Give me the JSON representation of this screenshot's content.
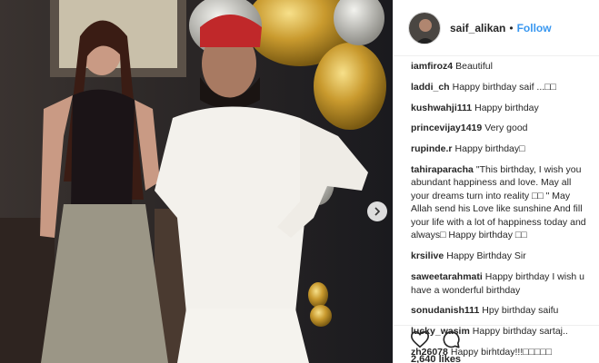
{
  "post": {
    "username": "saif_alikan",
    "separator": "•",
    "follow_label": "Follow",
    "likes": "2,640 likes"
  },
  "comments": [
    {
      "user": "iamfiroz4",
      "text": "Beautiful"
    },
    {
      "user": "laddi_ch",
      "text": "Happy birthday saif ...□□"
    },
    {
      "user": "kushwahji111",
      "text": "Happy birthday"
    },
    {
      "user": "princevijay1419",
      "text": "Very good"
    },
    {
      "user": "rupinde.r",
      "text": "Happy birthday□"
    },
    {
      "user": "tahiraparacha",
      "text": "\"This birthday, I wish you abundant happiness and love. May all your dreams turn into reality □□ \" May Allah send his Love like sunshine And fill your life with a lot of happiness today and always□ Happy birthday □□"
    },
    {
      "user": "krsilive",
      "text": "Happy Birthday Sir"
    },
    {
      "user": "saweetarahmati",
      "text": "Happy birthday I wish u have a wonderful birthday"
    },
    {
      "user": "sonudanish111",
      "text": "Hpy birthday saifu"
    },
    {
      "user": "lucky_wasim",
      "text": "Happy birthday sartaj.."
    },
    {
      "user": "zh26078",
      "text": "Happy birhtday!!!□□□□□"
    }
  ],
  "icons": {
    "avatar": "avatar",
    "next": "chevron-right-icon",
    "like": "heart-icon",
    "comment": "comment-icon"
  },
  "colors": {
    "link": "#3897f0",
    "text": "#262626",
    "divider": "#efefef"
  }
}
